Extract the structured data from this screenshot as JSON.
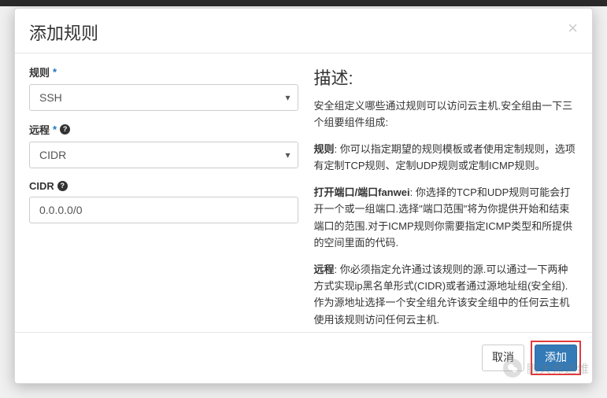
{
  "modal": {
    "title": "添加规则",
    "close_symbol": "×"
  },
  "form": {
    "rule": {
      "label": "规则",
      "value": "SSH"
    },
    "remote": {
      "label": "远程",
      "value": "CIDR"
    },
    "cidr": {
      "label": "CIDR",
      "value": "0.0.0.0/0"
    },
    "help_glyph": "?"
  },
  "description": {
    "title": "描述:",
    "intro": "安全组定义哪些通过规则可以访问云主机.安全组由一下三个组要组件组成:",
    "rule_label": "规则",
    "rule_text": ": 你可以指定期望的规则模板或者使用定制规则，选项有定制TCP规则、定制UDP规则或定制ICMP规则。",
    "port_label": "打开端口/端口fanwei",
    "port_text": ": 你选择的TCP和UDP规则可能会打开一个或一组端口.选择\"端口范围\"将为你提供开始和结束端口的范围.对于ICMP规则你需要指定ICMP类型和所提供的空间里面的代码.",
    "remote_label": "远程",
    "remote_text": ": 你必须指定允许通过该规则的源.可以通过一下两种方式实现ip黑名单形式(CIDR)或者通过源地址组(安全组).作为源地址选择一个安全组允许该安全组中的任何云主机使用该规则访问任何云主机."
  },
  "footer": {
    "cancel": "取消",
    "add": "添加"
  },
  "watermark": {
    "text": "鹏大师运维"
  }
}
